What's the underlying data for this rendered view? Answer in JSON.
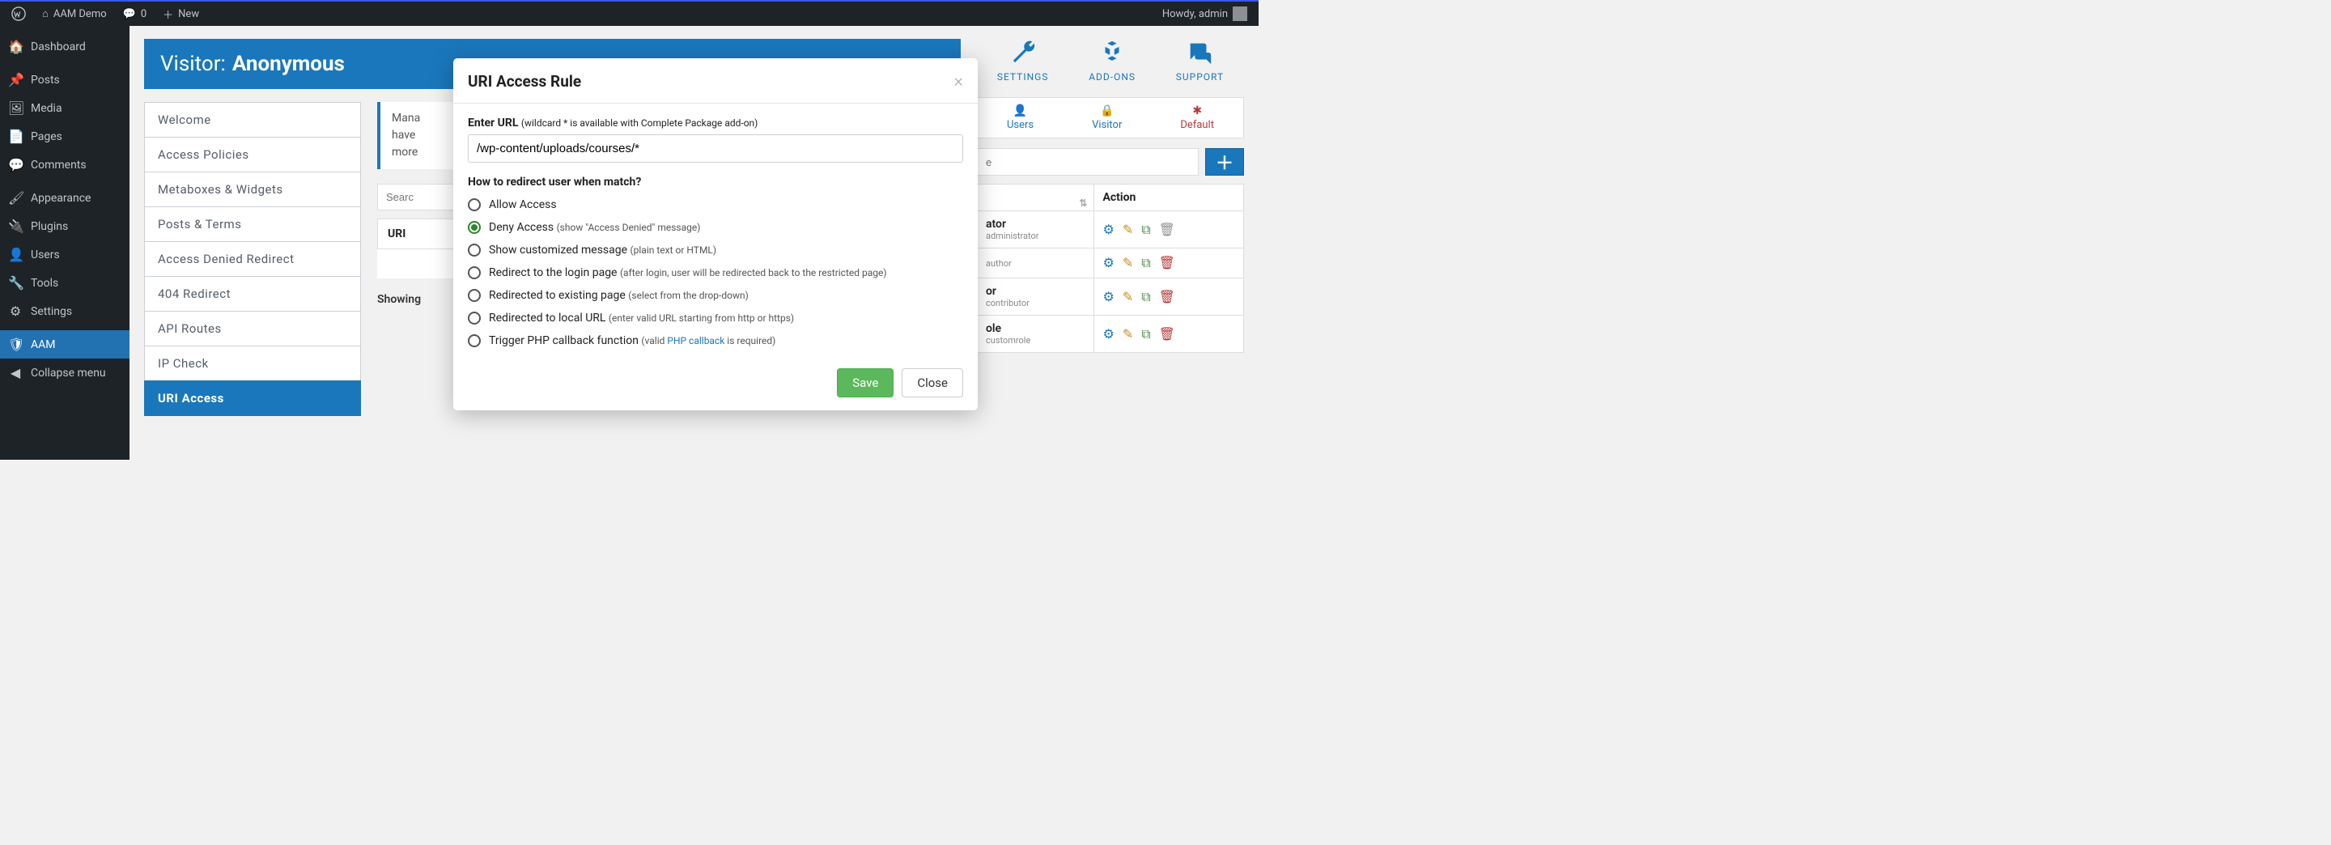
{
  "adminbar": {
    "site": "AAM Demo",
    "comments": "0",
    "new": "New",
    "howdy": "Howdy, admin"
  },
  "sidebar": {
    "items": [
      {
        "label": "Dashboard",
        "icon": "🏠"
      },
      {
        "label": "Posts",
        "icon": "📌"
      },
      {
        "label": "Media",
        "icon": "🖼"
      },
      {
        "label": "Pages",
        "icon": "📄"
      },
      {
        "label": "Comments",
        "icon": "💬"
      },
      {
        "label": "Appearance",
        "icon": "🖌"
      },
      {
        "label": "Plugins",
        "icon": "🔌"
      },
      {
        "label": "Users",
        "icon": "👤"
      },
      {
        "label": "Tools",
        "icon": "🔧"
      },
      {
        "label": "Settings",
        "icon": "⚙"
      },
      {
        "label": "AAM",
        "icon": "🛡"
      },
      {
        "label": "Collapse menu",
        "icon": "◀"
      }
    ]
  },
  "visitor": {
    "prefix": "Visitor:",
    "name": "Anonymous"
  },
  "tabs": [
    "Welcome",
    "Access Policies",
    "Metaboxes & Widgets",
    "Posts & Terms",
    "Access Denied Redirect",
    "404 Redirect",
    "API Routes",
    "IP Check",
    "URI Access"
  ],
  "info_text": "Mana… have … more…",
  "search_placeholder": "Searc",
  "table": {
    "col1": "URI"
  },
  "showing": "Showing",
  "top_icons": {
    "settings": "SETTINGS",
    "addons": "ADD-ONS",
    "support": "SUPPORT"
  },
  "filters": {
    "users": "Users",
    "visitor": "Visitor",
    "default": "Default"
  },
  "roles": {
    "search_placeholder": "e",
    "col_action": "Action",
    "rows": [
      {
        "name": "ator",
        "sub": "administrator",
        "trash_muted": true
      },
      {
        "name": "",
        "sub": "author",
        "trash_muted": false
      },
      {
        "name": "or",
        "sub": "contributor",
        "trash_muted": false
      },
      {
        "name": "ole",
        "sub": "customrole",
        "trash_muted": false
      }
    ]
  },
  "modal": {
    "title": "URI Access Rule",
    "url_label": "Enter URL",
    "url_hint": "(wildcard * is available with Complete Package add-on)",
    "url_value": "/wp-content/uploads/courses/*",
    "redirect_label": "How to redirect user when match?",
    "options": [
      {
        "label": "Allow Access",
        "hint": "",
        "selected": false
      },
      {
        "label": "Deny Access",
        "hint": "(show \"Access Denied\" message)",
        "selected": true
      },
      {
        "label": "Show customized message",
        "hint": "(plain text or HTML)",
        "selected": false
      },
      {
        "label": "Redirect to the login page",
        "hint": "(after login, user will be redirected back to the restricted page)",
        "selected": false
      },
      {
        "label": "Redirected to existing page",
        "hint": "(select from the drop-down)",
        "selected": false
      },
      {
        "label": "Redirected to local URL",
        "hint": "(enter valid URL starting from http or https)",
        "selected": false
      },
      {
        "label": "Trigger PHP callback function",
        "hint_prefix": "(valid ",
        "hint_link": "PHP callback",
        "hint_suffix": " is required)",
        "selected": false
      }
    ],
    "save": "Save",
    "close": "Close"
  }
}
